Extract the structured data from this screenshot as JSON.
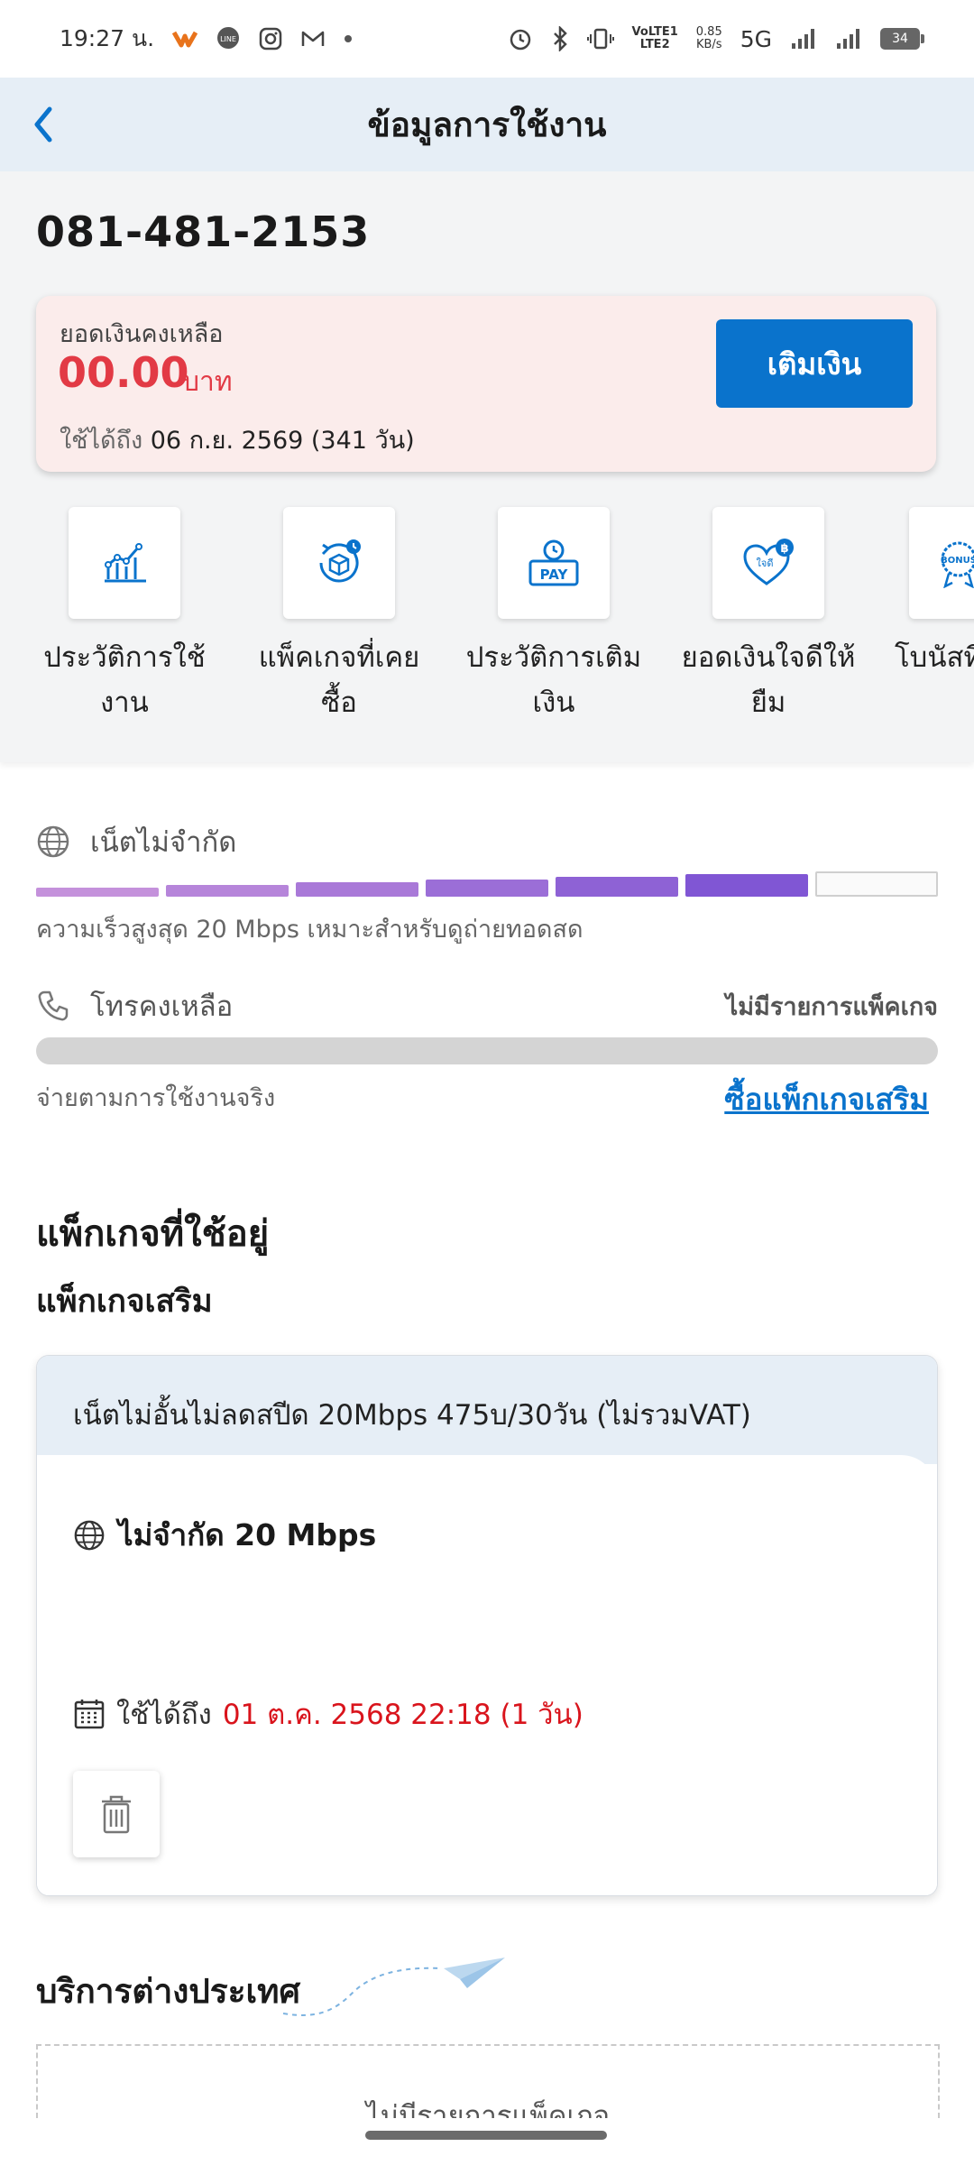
{
  "status_bar": {
    "time": "19:27 น.",
    "net_speed_value": "0.85",
    "net_speed_unit": "KB/s",
    "volte": "VoLTE1",
    "lte": "LTE2",
    "network": "5G",
    "battery": "34"
  },
  "header": {
    "title": "ข้อมูลการใช้งาน"
  },
  "account": {
    "phone_number": "081-481-2153"
  },
  "balance": {
    "label": "ยอดเงินคงเหลือ",
    "amount": "00.00",
    "unit": "บาท",
    "valid_prefix": "ใช้ได้ถึง",
    "valid_until": "06 ก.ย. 2569 (341 วัน)",
    "topup_label": "เติมเงิน",
    "amount_color": "#e23a45",
    "button_color": "#0a73cc"
  },
  "menu": [
    {
      "label_line1": "ประวัติการใช้",
      "label_line2": "งาน",
      "icon": "usage-history-chart-icon"
    },
    {
      "label_line1": "แพ็คเกจที่เคย",
      "label_line2": "ซื้อ",
      "icon": "package-history-box-icon"
    },
    {
      "label_line1": "ประวัติการเติม",
      "label_line2": "เงิน",
      "icon": "topup-history-pay-icon"
    },
    {
      "label_line1": "ยอดเงินใจดีให้",
      "label_line2": "ยืม",
      "icon": "loan-heart-icon"
    },
    {
      "label_line1": "โบนัสที่",
      "label_line2": "",
      "icon": "bonus-badge-icon"
    }
  ],
  "menu_icon_text": {
    "pay": "PAY",
    "heart": "ใจดี",
    "bonus": "BONUS"
  },
  "internet": {
    "label": "เน็ตไม่จำกัด",
    "speed_note": "ความเร็วสูงสุด 20 Mbps เหมาะสำหรับดูถ่ายทอดสด",
    "filled_segments": 6,
    "total_segments": 7,
    "bar_color": "#b98ad8"
  },
  "calls": {
    "label": "โทรคงเหลือ",
    "status": "ไม่มีรายการแพ็คเกจ",
    "pay_note": "จ่ายตามการใช้งานจริง",
    "buy_link": "ซื้อแพ็กเกจเสริม"
  },
  "packages": {
    "title": "แพ็กเกจที่ใช้อยู่",
    "subtitle": "แพ็กเกจเสริม",
    "card": {
      "name": "เน็ตไม่อั้นไม่ลดสปีด 20Mbps 475บ/30วัน (ไม่รวมVAT)",
      "feature": "ไม่จำกัด 20 Mbps",
      "valid_prefix": "ใช้ได้ถึง",
      "valid_until": "01 ต.ค. 2568 22:18 (1 วัน)",
      "valid_color": "#d9141c"
    }
  },
  "international": {
    "title": "บริการต่างประเทศ",
    "empty_text": "ไม่มีรายการแพ็คเกจ"
  }
}
